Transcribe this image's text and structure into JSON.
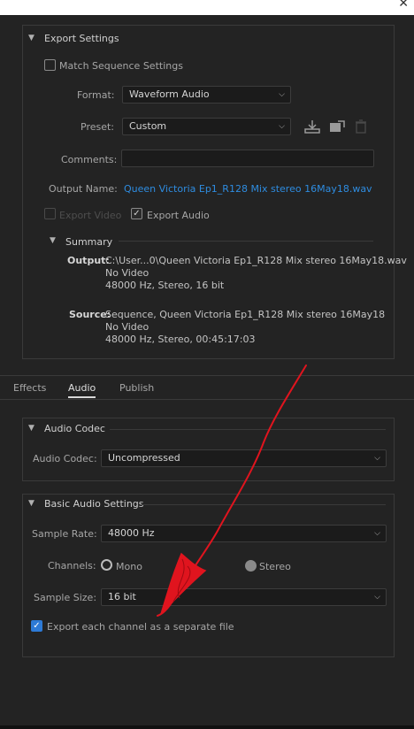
{
  "window": {
    "close_glyph": "✕"
  },
  "export_settings": {
    "header": "Export Settings",
    "match_sequence_label": "Match Sequence Settings",
    "format_label": "Format:",
    "format_value": "Waveform Audio",
    "preset_label": "Preset:",
    "preset_value": "Custom",
    "comments_label": "Comments:",
    "comments_value": "",
    "output_name_label": "Output Name:",
    "output_name_value": "Queen Victoria Ep1_R128 Mix stereo 16May18.wav",
    "export_video_label": "Export Video",
    "export_audio_label": "Export Audio",
    "summary": {
      "header": "Summary",
      "output_label": "Output:",
      "output_lines": [
        "C:\\User...0\\Queen Victoria Ep1_R128 Mix stereo 16May18.wav",
        "No Video",
        "48000 Hz, Stereo, 16 bit"
      ],
      "source_label": "Source:",
      "source_lines": [
        "Sequence, Queen Victoria Ep1_R128 Mix stereo 16May18",
        "No Video",
        "48000 Hz, Stereo, 00:45:17:03"
      ]
    }
  },
  "tabs": [
    {
      "label": "Effects"
    },
    {
      "label": "Audio"
    },
    {
      "label": "Publish"
    }
  ],
  "audio_codec": {
    "header": "Audio Codec",
    "codec_label": "Audio Codec:",
    "codec_value": "Uncompressed"
  },
  "basic_audio": {
    "header": "Basic Audio Settings",
    "sample_rate_label": "Sample Rate:",
    "sample_rate_value": "48000 Hz",
    "channels_label": "Channels:",
    "mono_label": "Mono",
    "stereo_label": "Stereo",
    "sample_size_label": "Sample Size:",
    "sample_size_value": "16 bit",
    "separate_file_label": "Export each channel as a separate file"
  },
  "colors": {
    "accent": "#2e8ce0",
    "annotation": "#e0141e",
    "checkbox_checked": "#2d7ad6"
  },
  "icons": [
    "close-icon",
    "chevron-down-icon",
    "save-preset-icon",
    "import-preset-icon",
    "delete-preset-icon",
    "checkmark-icon"
  ]
}
